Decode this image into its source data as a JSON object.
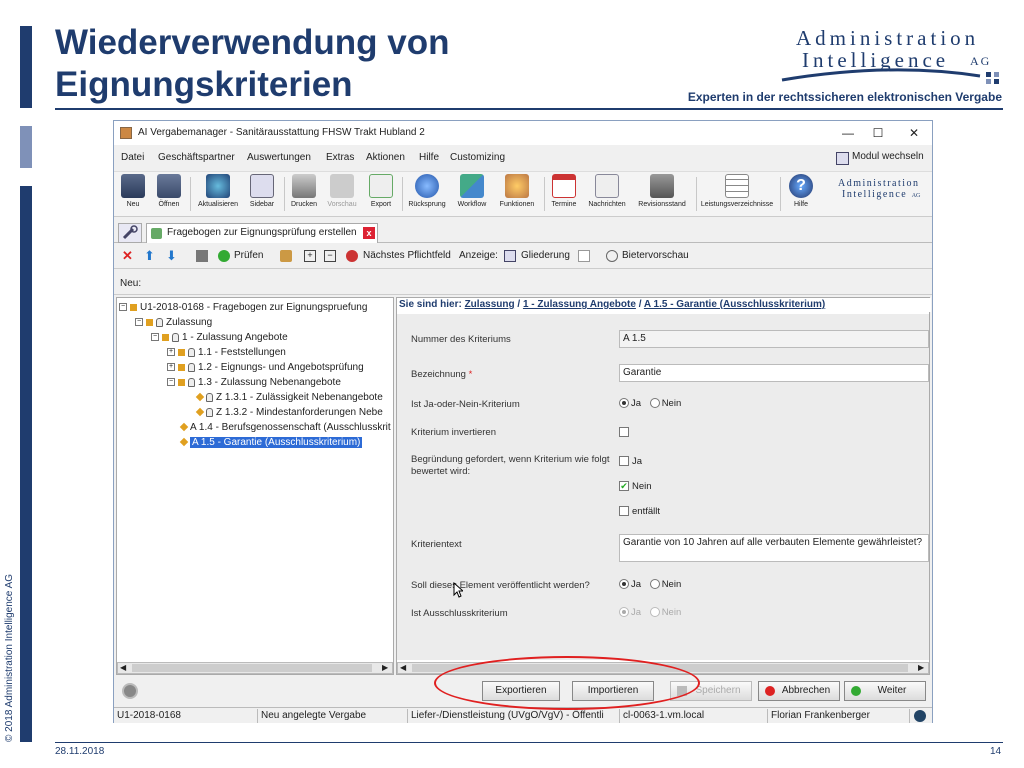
{
  "slide": {
    "title_line1": "Wiederverwendung von",
    "title_line2": "Eignungskriterien",
    "logo_line1": "Administration",
    "logo_line2": "Intelligence",
    "logo_ag": "AG",
    "tagline": "Experten in der rechtssicheren elektronischen Vergabe",
    "copyright": "© 2018 Administration Intelligence AG",
    "date": "28.11.2018",
    "page": "14",
    "accent": "#1f3c6e"
  },
  "window": {
    "title": "AI Vergabemanager - Sanitärausstattung FHSW Trakt Hubland 2",
    "minimize": "—",
    "maximize": "☐",
    "close": "✕"
  },
  "menu": {
    "items": [
      "Datei",
      "Geschäftspartner",
      "Auswertungen",
      "Extras",
      "Aktionen",
      "Hilfe",
      "Customizing"
    ],
    "modul_wechseln": "Modul wechseln"
  },
  "toolbar": {
    "buttons": [
      "Neu",
      "Öffnen",
      "Aktualisieren",
      "Sidebar",
      "Drucken",
      "Vorschau",
      "Export",
      "Rücksprung",
      "Workflow",
      "Funktionen",
      "Termine",
      "Nachrichten",
      "Revisionsstand",
      "Leistungsverzeichnisse",
      "Hilfe"
    ],
    "logo_line1": "Administration",
    "logo_line2": "Intelligence",
    "logo_ag": "AG"
  },
  "tabs": {
    "main_label": "Fragebogen zur Eignungsprüfung erstellen",
    "close": "x"
  },
  "actions": {
    "pruefen": "Prüfen",
    "naechstes": "Nächstes Pflichtfeld",
    "anzeige": "Anzeige:",
    "gliederung": "Gliederung",
    "bietervorschau": "Bietervorschau"
  },
  "new_label": "Neu:",
  "tree": {
    "nodes": [
      {
        "text": "U1-2018-0168 - Fragebogen zur Eignungspruefung"
      },
      {
        "text": "Zulassung"
      },
      {
        "text": "1 - Zulassung Angebote"
      },
      {
        "text": "1.1 - Feststellungen"
      },
      {
        "text": "1.2 - Eignungs- und Angebotsprüfung"
      },
      {
        "text": "1.3 - Zulassung Nebenangebote"
      },
      {
        "text": "Z 1.3.1 - Zulässigkeit Nebenangebote"
      },
      {
        "text": "Z 1.3.2 - Mindestanforderungen Nebe"
      },
      {
        "text": "A 1.4 - Berufsgenossenschaft (Ausschlusskrit"
      },
      {
        "text": "A 1.5 - Garantie (Ausschlusskriterium)"
      }
    ]
  },
  "breadcrumb": {
    "prefix": "Sie sind hier:",
    "items": [
      "Zulassung",
      "1 - Zulassung Angebote",
      "A 1.5 - Garantie (Ausschlusskriterium)"
    ],
    "sep": "/"
  },
  "form": {
    "nummer_label": "Nummer des Kriteriums",
    "nummer_value": "A 1.5",
    "bezeichnung_label": "Bezeichnung",
    "required_mark": "*",
    "bezeichnung_value": "Garantie",
    "janein_label": "Ist Ja-oder-Nein-Kriterium",
    "ja": "Ja",
    "nein": "Nein",
    "invertieren_label": "Kriterium invertieren",
    "begruendung_label": "Begründung gefordert, wenn Kriterium wie folgt bewertet wird:",
    "entfaellt": "entfällt",
    "kriterientext_label": "Kriterientext",
    "kriterientext_value": "Garantie von 10 Jahren auf alle verbauten Elemente gewährleistet?",
    "veroeffentlicht_label": "Soll dieses Element veröffentlicht werden?",
    "ausschluss_label": "Ist Ausschlusskriterium"
  },
  "buttons": {
    "exportieren": "Exportieren",
    "importieren": "Importieren",
    "speichern": "Speichern",
    "abbrechen": "Abbrechen",
    "weiter": "Weiter"
  },
  "status": {
    "segments": [
      "U1-2018-0168",
      "Neu angelegte Vergabe",
      "Liefer-/Dienstleistung (UVgO/VgV) - Öffentli",
      "cl-0063-1.vm.local",
      "Florian Frankenberger"
    ]
  }
}
